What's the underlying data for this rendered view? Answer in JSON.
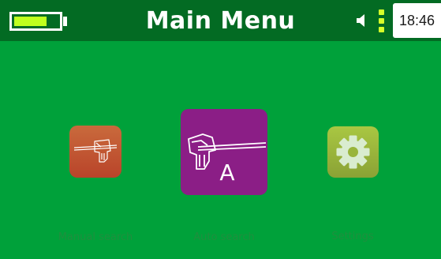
{
  "header": {
    "title": "Main Menu",
    "time": "18:46",
    "battery_level": 0.75,
    "signal_level": 3,
    "speaker_icon": "speaker-icon"
  },
  "menu": {
    "items": [
      {
        "label": "Manual search",
        "icon": "manual-detector-icon",
        "selected": false,
        "color": "#c8522c"
      },
      {
        "label": "Auto search",
        "icon": "auto-detector-icon",
        "badge": "A",
        "selected": true,
        "color": "#8b1e86"
      },
      {
        "label": "Settings",
        "icon": "gear-icon",
        "selected": false,
        "color": "#99b53b"
      }
    ]
  },
  "colors": {
    "background": "#00a13a",
    "header": "#036b23",
    "accent": "#c0ff1f"
  }
}
